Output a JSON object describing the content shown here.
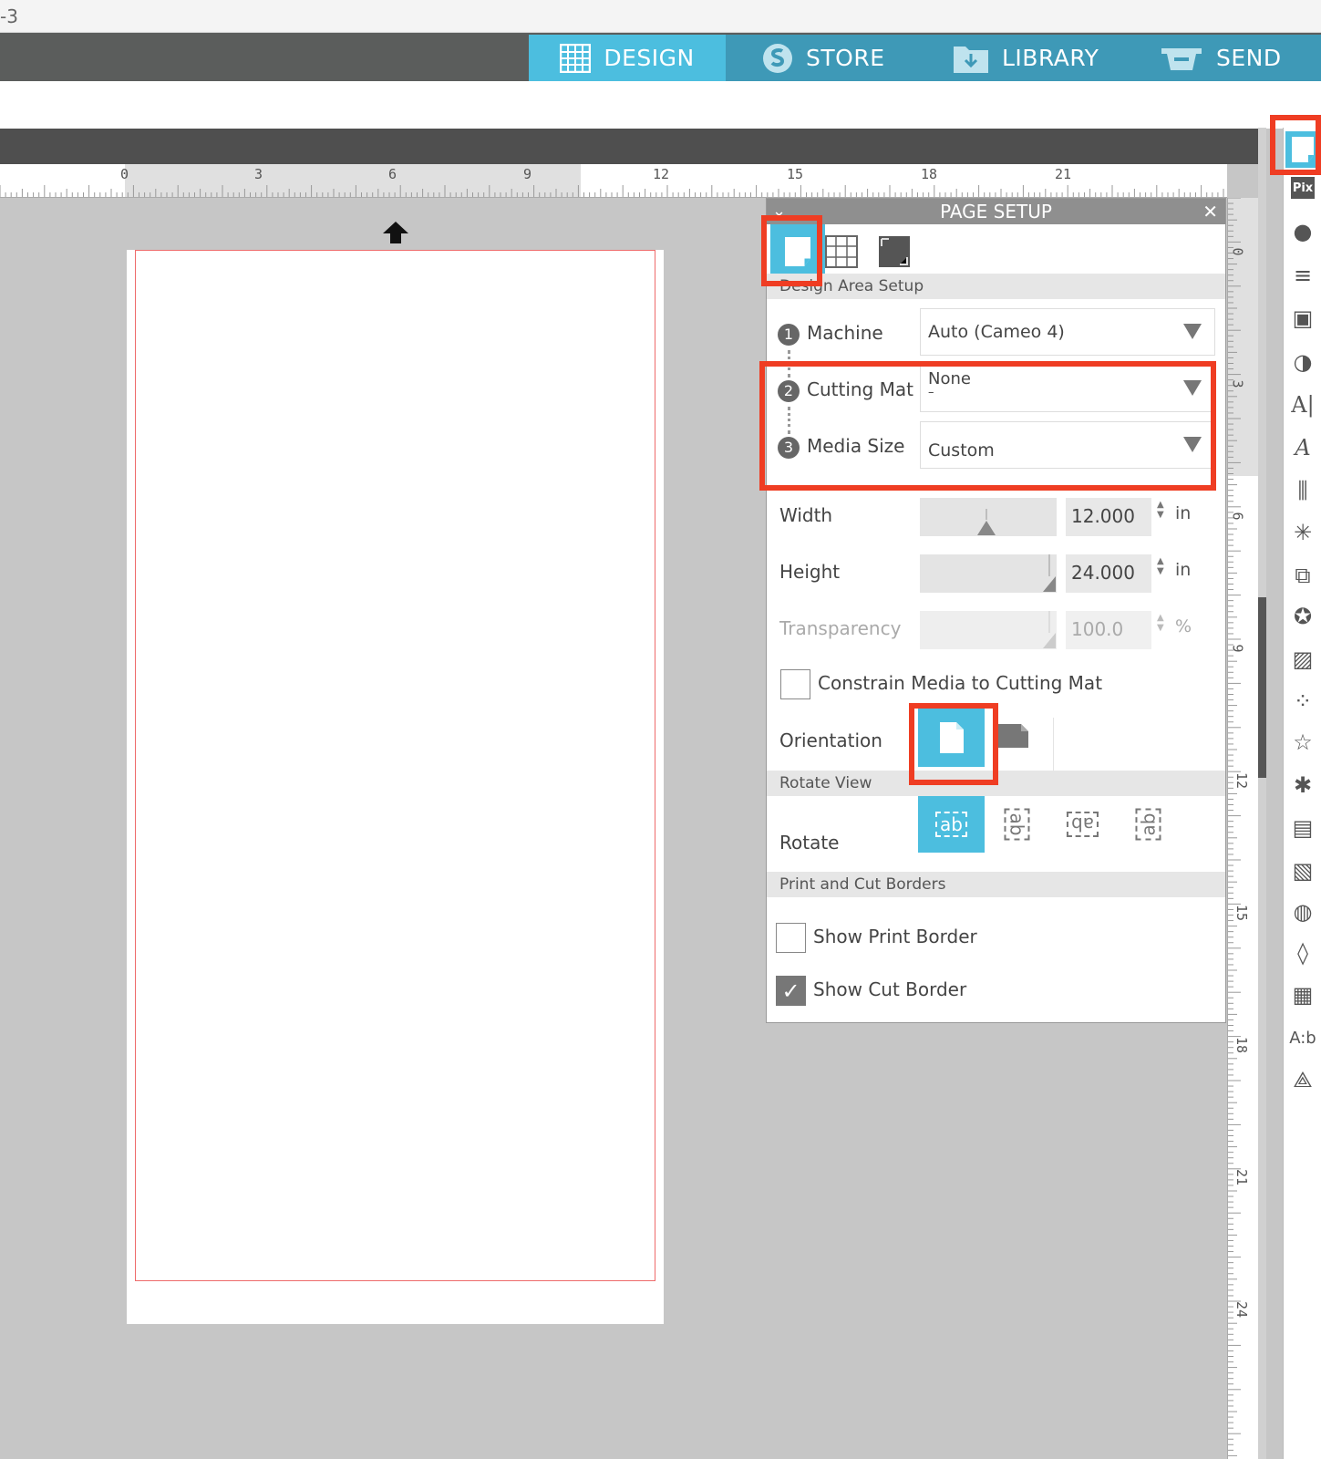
{
  "titlebar": {
    "text": "-3"
  },
  "nav": {
    "design": "DESIGN",
    "store": "STORE",
    "library": "LIBRARY",
    "send": "SEND"
  },
  "hruler": {
    "ticks": [
      "0",
      "3",
      "6",
      "9",
      "12",
      "15",
      "18",
      "21"
    ]
  },
  "vruler": {
    "ticks": [
      "0",
      "3",
      "6",
      "9",
      "12",
      "15",
      "18",
      "21",
      "24"
    ]
  },
  "panel": {
    "title": "PAGE SETUP",
    "section_design_area": "Design Area Setup",
    "machine": {
      "num": "1",
      "label": "Machine",
      "value": "Auto (Cameo 4)"
    },
    "cutting_mat": {
      "num": "2",
      "label": "Cutting Mat",
      "value": "None",
      "sub": "–"
    },
    "media_size": {
      "num": "3",
      "label": "Media Size",
      "value": "Custom"
    },
    "width": {
      "label": "Width",
      "value": "12.000",
      "unit": "in"
    },
    "height": {
      "label": "Height",
      "value": "24.000",
      "unit": "in"
    },
    "transparency": {
      "label": "Transparency",
      "value": "100.0",
      "unit": "%"
    },
    "constrain": {
      "label": "Constrain Media to Cutting Mat",
      "checked": false
    },
    "orientation": {
      "label": "Orientation",
      "selected": "portrait"
    },
    "section_rotate": "Rotate View",
    "rotate_label": "Rotate",
    "rotate_options": [
      "ab",
      "ab",
      "ab",
      "ab"
    ],
    "section_borders": "Print and Cut Borders",
    "show_print_border": {
      "label": "Show Print Border",
      "checked": false
    },
    "show_cut_border": {
      "label": "Show Cut Border",
      "checked": true
    }
  },
  "toolbar": {
    "pix_label": "Pix",
    "text_label": "A|",
    "ab_label": "A:b"
  },
  "colors": {
    "accent": "#4cbedf",
    "highlight": "#ef3d23",
    "nav": "#3e99b7"
  }
}
